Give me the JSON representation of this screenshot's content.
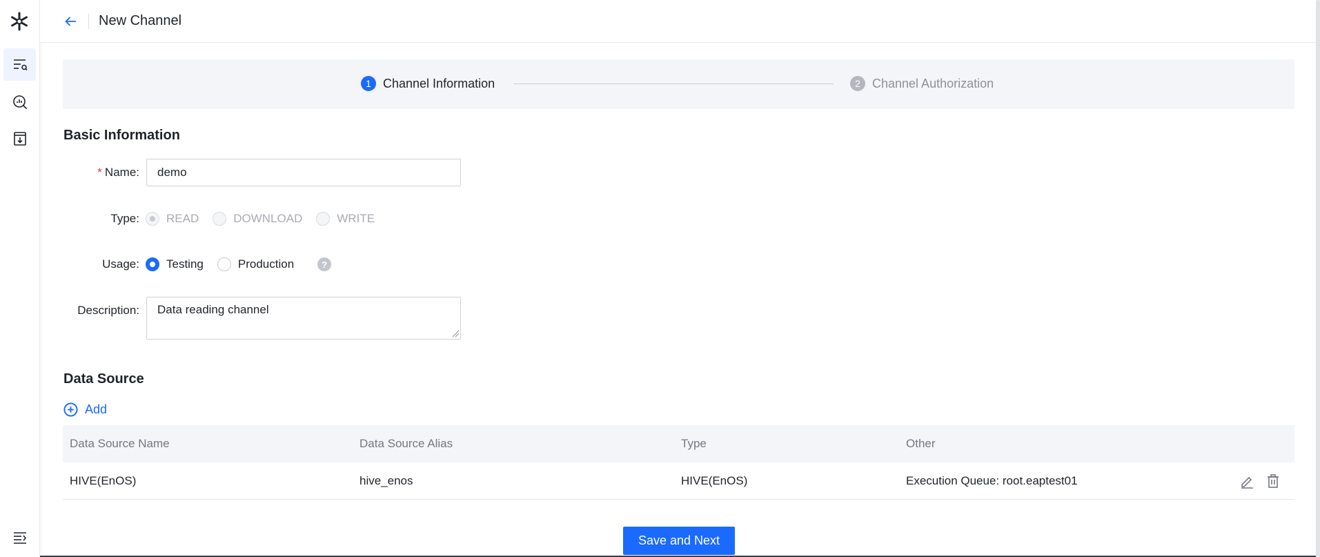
{
  "header": {
    "title": "New Channel"
  },
  "steps": [
    {
      "num": "1",
      "label": "Channel Information"
    },
    {
      "num": "2",
      "label": "Channel Authorization"
    }
  ],
  "basic": {
    "title": "Basic Information",
    "name_label": "Name:",
    "name_value": "demo",
    "type_label": "Type:",
    "type_options": [
      "READ",
      "DOWNLOAD",
      "WRITE"
    ],
    "usage_label": "Usage:",
    "usage_options": [
      "Testing",
      "Production"
    ],
    "help": "?",
    "description_label": "Description:",
    "description_value": "Data reading channel"
  },
  "datasource": {
    "title": "Data Source",
    "add_label": "Add",
    "columns": [
      "Data Source Name",
      "Data Source Alias",
      "Type",
      "Other"
    ],
    "rows": [
      {
        "name": "HIVE(EnOS)",
        "alias": "hive_enos",
        "type": "HIVE(EnOS)",
        "other": "Execution Queue: root.eaptest01"
      }
    ]
  },
  "footer": {
    "save_label": "Save and Next"
  },
  "colors": {
    "primary": "#1a6aff",
    "required": "#e23b3b"
  }
}
